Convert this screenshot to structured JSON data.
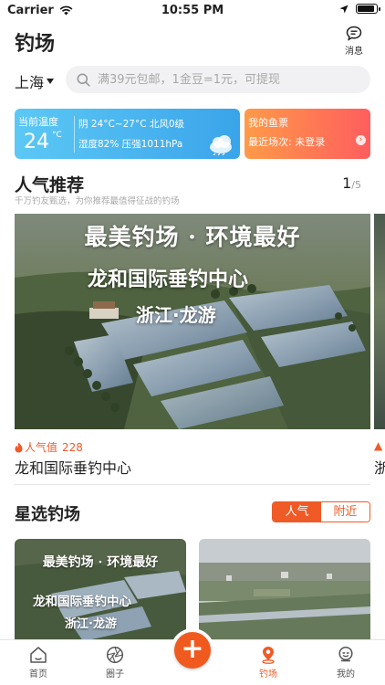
{
  "status_bar": {
    "carrier": "Carrier",
    "time": "10:55 PM"
  },
  "header": {
    "title": "钓场",
    "message_label": "消息"
  },
  "location": {
    "city": "上海"
  },
  "search": {
    "placeholder": "满39元包邮，1金豆=1元，可提现"
  },
  "weather": {
    "label": "当前温度",
    "temperature": "24",
    "unit": "°C",
    "condition": "阴 24°C~27°C 北风0级",
    "humidity_pressure": "湿度82%  压强1011hPa"
  },
  "ticket": {
    "title": "我的鱼票",
    "recent": "最近场次: 未登录",
    "arrow": "›"
  },
  "popular": {
    "title": "人气推荐",
    "subtitle": "千万钓友甄选，为你推荐最值得征战的钓场",
    "page_current": "1",
    "page_total": "/5",
    "banner": {
      "headline": "最美钓场 · 环境最好",
      "center_name": "龙和国际垂钓中心",
      "region": "浙江·龙游"
    },
    "hot_label": "人气值",
    "hot_value": "228",
    "spot_name": "龙和国际垂钓中心",
    "peek_name": "浙"
  },
  "featured": {
    "title": "星选钓场",
    "tabs": [
      "人气",
      "附近"
    ],
    "card1": {
      "headline": "最美钓场 · 环境最好",
      "center_name": "龙和国际垂钓中心",
      "region": "浙江·龙游"
    }
  },
  "tabbar": {
    "items": [
      {
        "label": "首页",
        "icon": "home-icon"
      },
      {
        "label": "圈子",
        "icon": "aperture-icon"
      },
      {
        "label": "钓场",
        "icon": "location-pin-icon"
      },
      {
        "label": "我的",
        "icon": "user-icon"
      }
    ],
    "active_index": 2,
    "plus": "+"
  },
  "colors": {
    "accent": "#ef5a26",
    "weather_gradient": [
      "#5cc8f5",
      "#3aa4ea"
    ],
    "ticket_gradient": [
      "#ff9a48",
      "#ff5e5e"
    ]
  }
}
